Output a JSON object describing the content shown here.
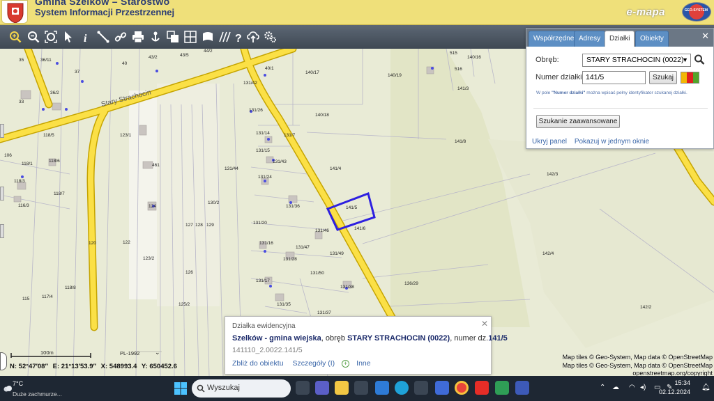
{
  "header": {
    "title_top": "Gmina Szelków – Starostwo",
    "title": "System Informacji Przestrzennej",
    "brand": "e-mapa",
    "brand_logo_text": "GEO-SYSTEM"
  },
  "toolbar": {
    "tools": [
      "zoom-in-icon",
      "zoom-out-icon",
      "zoom-extent-icon",
      "select-arrow-icon",
      "info-icon",
      "measure-icon",
      "link-icon",
      "print-icon",
      "download-icon",
      "layers-icon",
      "parcel-search-icon",
      "map-sheet-icon",
      "hatch-icon",
      "help-icon",
      "upload-icon",
      "settings-icon"
    ]
  },
  "panel": {
    "tabs": [
      "Współrzędne",
      "Adresy",
      "Działki",
      "Obiekty"
    ],
    "active_tab": "Działki",
    "obreb_label": "Obręb:",
    "obreb_value": "STARY STRACHOCIN (0022)",
    "numer_label": "Numer działki:",
    "numer_value": "141/5",
    "search_button": "Szukaj",
    "hint_prefix": "W pole ",
    "hint_bold": "\"Numer działki\"",
    "hint_suffix": " można wpisać pełny identyfikator szukanej działki.",
    "advanced_button": "Szukanie zaawansowane",
    "hide_link": "Ukryj panel",
    "single_window_link": "Pokazuj w jednym oknie",
    "swatch_colors": [
      "#f2b705",
      "#e02020",
      "#52a52a"
    ]
  },
  "map": {
    "place_label": "Stary Strachocin",
    "parcel_labels": [
      "35",
      "36/11",
      "37",
      "40",
      "43/2",
      "43/5",
      "44/2",
      "40/1",
      "140/17",
      "140/19",
      "515",
      "516",
      "140/16",
      "141/3",
      "131/42",
      "131/26",
      "140/18",
      "33",
      "36/2",
      "118/5",
      "123/1",
      "131/14",
      "131/7",
      "141/8",
      "106",
      "118/1",
      "118/6",
      "131/15",
      "131/43",
      "141/4",
      "118/3",
      "461",
      "131/44",
      "131/24",
      "142/3",
      "118/7",
      "116/3",
      "124",
      "130/2",
      "131/36",
      "141/5",
      "127",
      "128",
      "129",
      "131/20",
      "131/46",
      "141/6",
      "120",
      "122",
      "131/16",
      "131/47",
      "142/4",
      "123/2",
      "131/28",
      "131/49",
      "126",
      "118/8",
      "131/50",
      "115",
      "117/4",
      "131/17",
      "131/38",
      "136/29",
      "125/2",
      "131/35",
      "142/2",
      "131/37",
      "131/18",
      "136/13",
      "141/5 "
    ],
    "highlighted_parcel": "141/5"
  },
  "popup": {
    "title": "Działka ewidencyjna",
    "gmina": "Szelków - gmina wiejska",
    "obreb_text": ", obręb ",
    "obreb": "STARY STRACHOCIN (0022)",
    "numer_text": ", numer dz.",
    "numer": "141/5",
    "identifier": "141110_2.0022.141/5",
    "zoom_link": "Zbliż do obiektu",
    "details_link": "Szczegóły (I)",
    "more_link": "Inne"
  },
  "scale": {
    "label": "100m",
    "crs": "PL-1992"
  },
  "coords": {
    "lat": "N: 52°47′08″",
    "lon": "E: 21°13′53.9″",
    "x": "X: 548993.4",
    "y": "Y: 650452.6"
  },
  "attribution": {
    "line1": "Map tiles © Geo-System, Map data © OpenStreetMap",
    "line2": "Map tiles © Geo-System, Map data © OpenStreetMap",
    "line3": "openstreetmap.org/copyright"
  },
  "taskbar": {
    "temp": "7°C",
    "weather": "Duże zachmurze...",
    "search_placeholder": "Wyszukaj",
    "time": "15:34",
    "date": "02.12.2024"
  }
}
